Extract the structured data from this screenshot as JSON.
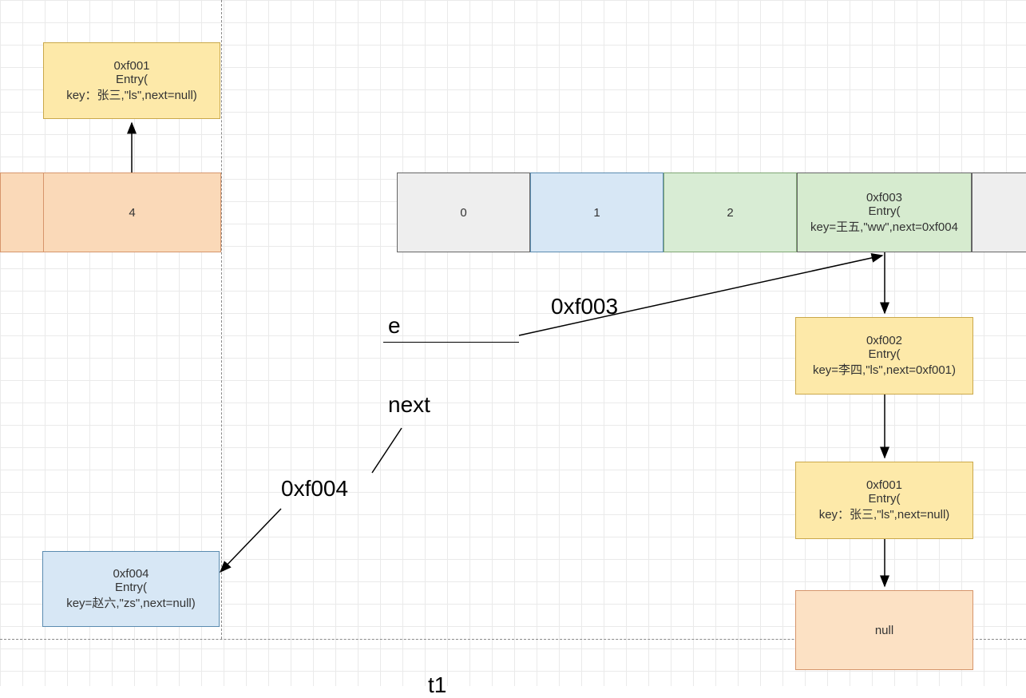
{
  "entry_top_left": {
    "addr": "0xf001",
    "type": "Entry(",
    "detail": "key：张三,\"ls\",next=null)"
  },
  "left_array": {
    "cell1": "",
    "cell2": "4"
  },
  "right_array": {
    "c0": "0",
    "c1": "1",
    "c2": "2",
    "c3_addr": "0xf003",
    "c3_type": "Entry(",
    "c3_detail": "key=王五,\"ww\",next=0xf004",
    "c4": ""
  },
  "chain_1": {
    "addr": "0xf002",
    "type": "Entry(",
    "detail": "key=李四,\"ls\",next=0xf001)"
  },
  "chain_2": {
    "addr": "0xf001",
    "type": "Entry(",
    "detail": "key：张三,\"ls\",next=null)"
  },
  "null_box": "null",
  "bottom_left_entry": {
    "addr": "0xf004",
    "type": "Entry(",
    "detail": "key=赵六,\"zs\",next=null)"
  },
  "labels": {
    "e": "e",
    "e_addr": "0xf003",
    "next": "next",
    "next_addr": "0xf004",
    "t1": "t1"
  }
}
